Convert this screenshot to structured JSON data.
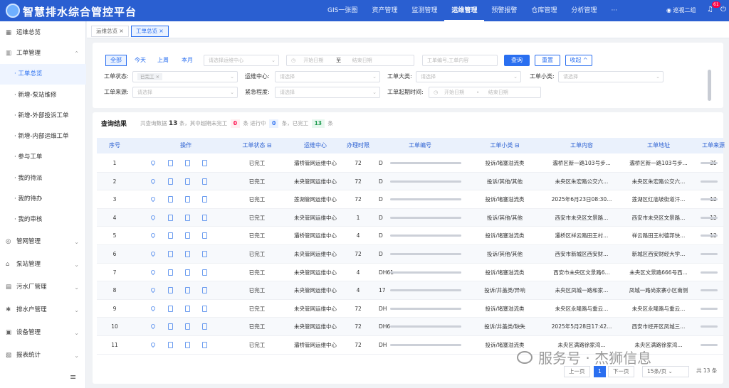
{
  "header": {
    "title": "智慧排水综合管控平台",
    "nav": [
      "GIS一张图",
      "资产管理",
      "监测管理",
      "运维管理",
      "预警报警",
      "仓库管理",
      "分析管理",
      "···"
    ],
    "active_nav": "运维管理",
    "user": "巡视二组",
    "badge": "61"
  },
  "sidebar": {
    "items": [
      {
        "label": "运维总览",
        "icon": "grid-icon",
        "type": "top"
      },
      {
        "label": "工单管理",
        "icon": "chart-icon",
        "type": "group",
        "expanded": true
      },
      {
        "label": "工单总览",
        "type": "sub",
        "active": true
      },
      {
        "label": "新增-泵站维修",
        "type": "sub"
      },
      {
        "label": "新增-外部投诉工单",
        "type": "sub"
      },
      {
        "label": "新增-内部运维工单",
        "type": "sub"
      },
      {
        "label": "参与工单",
        "type": "sub"
      },
      {
        "label": "我的待派",
        "type": "sub"
      },
      {
        "label": "我的待办",
        "type": "sub"
      },
      {
        "label": "我的审核",
        "type": "sub"
      },
      {
        "label": "管网管理",
        "icon": "network-icon",
        "type": "group"
      },
      {
        "label": "泵站管理",
        "icon": "pump-icon",
        "type": "group"
      },
      {
        "label": "污水厂管理",
        "icon": "plant-icon",
        "type": "group"
      },
      {
        "label": "排水户管理",
        "icon": "gear-icon",
        "type": "group"
      },
      {
        "label": "设备管理",
        "icon": "device-icon",
        "type": "group"
      },
      {
        "label": "报表统计",
        "icon": "report-icon",
        "type": "group"
      }
    ]
  },
  "tabs": [
    {
      "label": "运维总览 ×"
    },
    {
      "label": "工单总览 ×",
      "active": true
    }
  ],
  "filters": {
    "quick": [
      "全部",
      "今天",
      "上周",
      "本月"
    ],
    "center_placeholder": "请选择运维中心",
    "start_placeholder": "开始日期",
    "to": "至",
    "end_placeholder": "结束日期",
    "search_placeholder": "工单编号,工单内容",
    "query": "查询",
    "reset": "重置",
    "collapse": "收起 ^",
    "status_label": "工单状态:",
    "status_tag": "已完工 ×",
    "center_label": "运维中心:",
    "select_placeholder": "请选择",
    "big_label": "工单大类:",
    "small_label": "工单小类:",
    "source_label": "工单来源:",
    "urgency_label": "紧急程度:",
    "time_label": "工单起期时间:",
    "dash": "-"
  },
  "results": {
    "title": "查询结果",
    "prefix": "共查询数据",
    "total": "13",
    "mid1": "条，其中超期未完工",
    "overdue": "0",
    "mid2": "条 进行中",
    "progress": "0",
    "mid3": "条，已完工",
    "done": "13",
    "suffix": "条"
  },
  "table": {
    "columns": [
      "序号",
      "操作",
      "工单状态 ⊟",
      "运维中心",
      "办理时限",
      "工单编号",
      "工单小类 ⊟",
      "工单内容",
      "工单地址",
      "工单来源"
    ],
    "rows": [
      [
        "1",
        "已完工",
        "灞桥管网运维中心",
        "72",
        "D",
        "投诉/堵塞溢流类",
        "灞桥区新一路103号步...",
        "灞桥区新一路103号步...",
        "35"
      ],
      [
        "2",
        "已完工",
        "未央管网运维中心",
        "72",
        "D",
        "投诉/其他/其他",
        "未央区朱宏路公交六...",
        "未央区朱宏路公交六...",
        ""
      ],
      [
        "3",
        "已完工",
        "莲湖管网运维中心",
        "72",
        "D",
        "投诉/堵塞溢流类",
        "2025年6月23日08:30...",
        "莲湖区红庙坡街道汗...",
        "12"
      ],
      [
        "4",
        "已完工",
        "未央管网运维中心",
        "1",
        "D",
        "投诉/其他/其他",
        "西安市未央区文景路...",
        "西安市未央区文景路...",
        "12"
      ],
      [
        "5",
        "已完工",
        "灞桥管网运维中心",
        "4",
        "D",
        "投诉/堵塞溢流类",
        "灞桥区祥云路田王村...",
        "祥云路田王村德邦快...",
        "12"
      ],
      [
        "6",
        "已完工",
        "未央管网运维中心",
        "72",
        "D",
        "投诉/其他/其他",
        "西安市新城区西安财...",
        "新城区西安财经大学...",
        ""
      ],
      [
        "7",
        "已完工",
        "未央管网运维中心",
        "4",
        "DH61",
        "投诉/堵塞溢流类",
        "西安市未央区文景路6...",
        "未央区文景路666号西...",
        ""
      ],
      [
        "8",
        "已完工",
        "未央管网运维中心",
        "4",
        "17",
        "投诉/井盖类/异响",
        "未央区凤城一路和家...",
        "凤城一路尚家寨小区南侧",
        ""
      ],
      [
        "9",
        "已完工",
        "未央管网运维中心",
        "72",
        "DH",
        "投诉/堵塞溢流类",
        "未央区永隆路与重云...",
        "未央区永隆路与重云...",
        ""
      ],
      [
        "10",
        "已完工",
        "未央管网运维中心",
        "72",
        "DH6",
        "投诉/井盖类/缺失",
        "2025年5月28日17:42...",
        "西安市经开区凤城三...",
        ""
      ],
      [
        "11",
        "已完工",
        "灞桥管网运维中心",
        "72",
        "DH",
        "投诉/堵塞溢流类",
        "未央区满路徐家湾...",
        "未央区满路徐家湾...",
        ""
      ]
    ]
  },
  "pagination": {
    "prev": "上一页",
    "current": "1",
    "next": "下一页",
    "size": "15条/页",
    "total": "共 13 条"
  },
  "watermark": "服务号 · 杰狮信息"
}
